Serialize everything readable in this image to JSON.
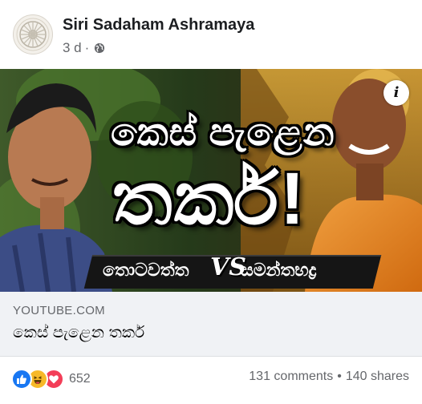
{
  "post": {
    "author": "Siri Sadaham Ashramaya",
    "time": "3 d",
    "privacy_icon": "globe-icon"
  },
  "thumbnail": {
    "headline_top": "කෙස් පැළෙන",
    "headline_big": "තර්ක!",
    "name_left": "තොටවත්ත",
    "vs": "VS",
    "name_right": "සමන්තභද්‍ර",
    "info_icon": "i"
  },
  "link": {
    "domain": "YOUTUBE.COM",
    "title": "කෙස් පැළෙන තර්ක"
  },
  "footer": {
    "reaction_icons": [
      "like-icon",
      "haha-icon",
      "love-icon"
    ],
    "reaction_count": "652",
    "comments": "131 comments",
    "separator": "•",
    "shares": "140 shares"
  },
  "colors": {
    "like": "#1877f2",
    "haha": "#f7b928",
    "love": "#f33e58",
    "caption_bg": "#f0f2f5",
    "secondary_text": "#65676b"
  }
}
